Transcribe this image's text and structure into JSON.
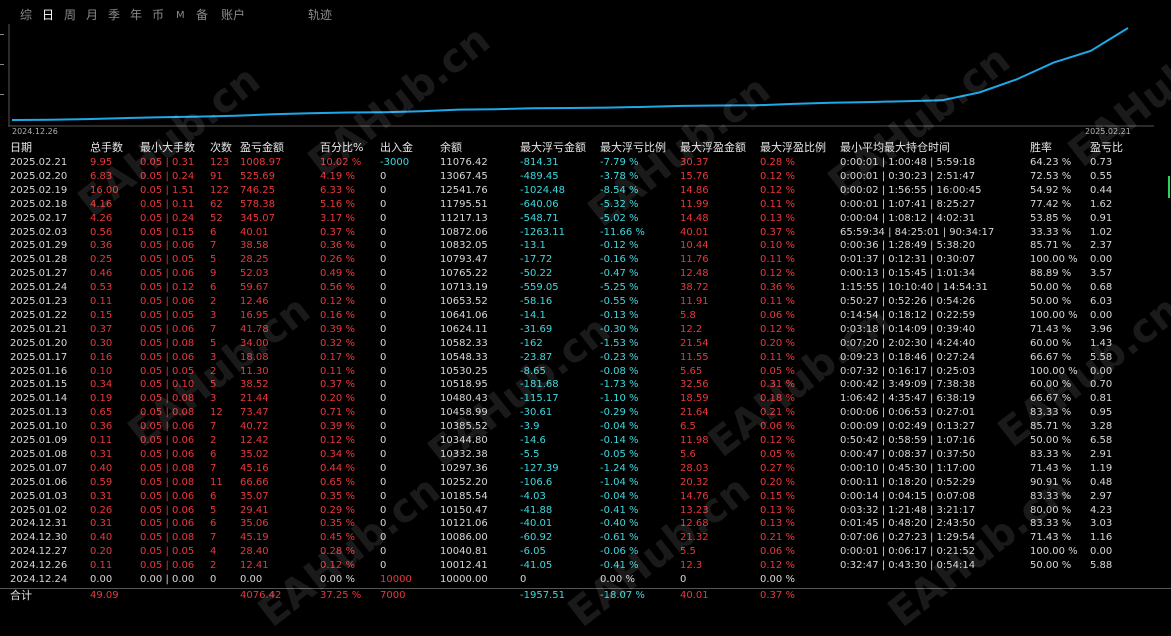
{
  "tabs": [
    {
      "label": "综",
      "active": false
    },
    {
      "label": "日",
      "active": true
    },
    {
      "label": "周",
      "active": false
    },
    {
      "label": "月",
      "active": false
    },
    {
      "label": "季",
      "active": false
    },
    {
      "label": "年",
      "active": false
    },
    {
      "label": "币",
      "active": false
    },
    {
      "label": "M",
      "active": false
    },
    {
      "label": "备",
      "active": false
    },
    {
      "label": "账户",
      "active": false
    },
    {
      "label": "轨迹",
      "active": false
    }
  ],
  "chart": {
    "start_date": "2024.12.26",
    "end_date": "2025.02.21",
    "line_color": "#1fa8e8"
  },
  "headers": [
    "日期",
    "总手数",
    "最小大手数",
    "次数",
    "盈亏金额",
    "百分比%",
    "出入金",
    "余额",
    "最大浮亏金额",
    "最大浮亏比例",
    "最大浮盈金额",
    "最大浮盈比例",
    "最小平均最大持仓时间",
    "胜率",
    "盈亏比"
  ],
  "rows": [
    [
      "2025.02.21",
      "9.95",
      "0.05 | 0.31",
      "123",
      "1008.97",
      "10.02 %",
      "-3000",
      "11076.42",
      "-814.31",
      "-7.79 %",
      "30.37",
      "0.28 %",
      "0:00:01 | 1:00:48 | 5:59:18",
      "64.23 %",
      "0.73"
    ],
    [
      "2025.02.20",
      "6.83",
      "0.05 | 0.24",
      "91",
      "525.69",
      "4.19 %",
      "0",
      "13067.45",
      "-489.45",
      "-3.78 %",
      "15.76",
      "0.12 %",
      "0:00:01 | 0:30:23 | 2:51:47",
      "72.53 %",
      "0.55"
    ],
    [
      "2025.02.19",
      "16.00",
      "0.05 | 1.51",
      "122",
      "746.25",
      "6.33 %",
      "0",
      "12541.76",
      "-1024.48",
      "-8.54 %",
      "14.86",
      "0.12 %",
      "0:00:02 | 1:56:55 | 16:00:45",
      "54.92 %",
      "0.44"
    ],
    [
      "2025.02.18",
      "4.16",
      "0.05 | 0.11",
      "62",
      "578.38",
      "5.16 %",
      "0",
      "11795.51",
      "-640.06",
      "-5.32 %",
      "11.99",
      "0.11 %",
      "0:00:01 | 1:07:41 | 8:25:27",
      "77.42 %",
      "1.62"
    ],
    [
      "2025.02.17",
      "4.26",
      "0.05 | 0.24",
      "52",
      "345.07",
      "3.17 %",
      "0",
      "11217.13",
      "-548.71",
      "-5.02 %",
      "14.48",
      "0.13 %",
      "0:00:04 | 1:08:12 | 4:02:31",
      "53.85 %",
      "0.91"
    ],
    [
      "2025.02.03",
      "0.56",
      "0.05 | 0.15",
      "6",
      "40.01",
      "0.37 %",
      "0",
      "10872.06",
      "-1263.11",
      "-11.66 %",
      "40.01",
      "0.37 %",
      "65:59:34 | 84:25:01 | 90:34:17",
      "33.33 %",
      "1.02"
    ],
    [
      "2025.01.29",
      "0.36",
      "0.05 | 0.06",
      "7",
      "38.58",
      "0.36 %",
      "0",
      "10832.05",
      "-13.1",
      "-0.12 %",
      "10.44",
      "0.10 %",
      "0:00:36 | 1:28:49 | 5:38:20",
      "85.71 %",
      "2.37"
    ],
    [
      "2025.01.28",
      "0.25",
      "0.05 | 0.05",
      "5",
      "28.25",
      "0.26 %",
      "0",
      "10793.47",
      "-17.72",
      "-0.16 %",
      "11.76",
      "0.11 %",
      "0:01:37 | 0:12:31 | 0:30:07",
      "100.00 %",
      "0.00"
    ],
    [
      "2025.01.27",
      "0.46",
      "0.05 | 0.06",
      "9",
      "52.03",
      "0.49 %",
      "0",
      "10765.22",
      "-50.22",
      "-0.47 %",
      "12.48",
      "0.12 %",
      "0:00:13 | 0:15:45 | 1:01:34",
      "88.89 %",
      "3.57"
    ],
    [
      "2025.01.24",
      "0.53",
      "0.05 | 0.12",
      "6",
      "59.67",
      "0.56 %",
      "0",
      "10713.19",
      "-559.05",
      "-5.25 %",
      "38.72",
      "0.36 %",
      "1:15:55 | 10:10:40 | 14:54:31",
      "50.00 %",
      "0.68"
    ],
    [
      "2025.01.23",
      "0.11",
      "0.05 | 0.06",
      "2",
      "12.46",
      "0.12 %",
      "0",
      "10653.52",
      "-58.16",
      "-0.55 %",
      "11.91",
      "0.11 %",
      "0:50:27 | 0:52:26 | 0:54:26",
      "50.00 %",
      "6.03"
    ],
    [
      "2025.01.22",
      "0.15",
      "0.05 | 0.05",
      "3",
      "16.95",
      "0.16 %",
      "0",
      "10641.06",
      "-14.1",
      "-0.13 %",
      "5.8",
      "0.06 %",
      "0:14:54 | 0:18:12 | 0:22:59",
      "100.00 %",
      "0.00"
    ],
    [
      "2025.01.21",
      "0.37",
      "0.05 | 0.06",
      "7",
      "41.78",
      "0.39 %",
      "0",
      "10624.11",
      "-31.69",
      "-0.30 %",
      "12.2",
      "0.12 %",
      "0:03:18 | 0:14:09 | 0:39:40",
      "71.43 %",
      "3.96"
    ],
    [
      "2025.01.20",
      "0.30",
      "0.05 | 0.08",
      "5",
      "34.00",
      "0.32 %",
      "0",
      "10582.33",
      "-162",
      "-1.53 %",
      "21.54",
      "0.20 %",
      "0:07:20 | 2:02:30 | 4:24:40",
      "60.00 %",
      "1.43"
    ],
    [
      "2025.01.17",
      "0.16",
      "0.05 | 0.06",
      "3",
      "18.08",
      "0.17 %",
      "0",
      "10548.33",
      "-23.87",
      "-0.23 %",
      "11.55",
      "0.11 %",
      "0:09:23 | 0:18:46 | 0:27:24",
      "66.67 %",
      "5.58"
    ],
    [
      "2025.01.16",
      "0.10",
      "0.05 | 0.05",
      "2",
      "11.30",
      "0.11 %",
      "0",
      "10530.25",
      "-8.65",
      "-0.08 %",
      "5.65",
      "0.05 %",
      "0:07:32 | 0:16:17 | 0:25:03",
      "100.00 %",
      "0.00"
    ],
    [
      "2025.01.15",
      "0.34",
      "0.05 | 0.10",
      "5",
      "38.52",
      "0.37 %",
      "0",
      "10518.95",
      "-181.68",
      "-1.73 %",
      "32.56",
      "0.31 %",
      "0:00:42 | 3:49:09 | 7:38:38",
      "60.00 %",
      "0.70"
    ],
    [
      "2025.01.14",
      "0.19",
      "0.05 | 0.08",
      "3",
      "21.44",
      "0.20 %",
      "0",
      "10480.43",
      "-115.17",
      "-1.10 %",
      "18.59",
      "0.18 %",
      "1:06:42 | 4:35:47 | 6:38:19",
      "66.67 %",
      "0.81"
    ],
    [
      "2025.01.13",
      "0.65",
      "0.05 | 0.08",
      "12",
      "73.47",
      "0.71 %",
      "0",
      "10458.99",
      "-30.61",
      "-0.29 %",
      "21.64",
      "0.21 %",
      "0:00:06 | 0:06:53 | 0:27:01",
      "83.33 %",
      "0.95"
    ],
    [
      "2025.01.10",
      "0.36",
      "0.05 | 0.06",
      "7",
      "40.72",
      "0.39 %",
      "0",
      "10385.52",
      "-3.9",
      "-0.04 %",
      "6.5",
      "0.06 %",
      "0:00:09 | 0:02:49 | 0:13:27",
      "85.71 %",
      "3.28"
    ],
    [
      "2025.01.09",
      "0.11",
      "0.05 | 0.06",
      "2",
      "12.42",
      "0.12 %",
      "0",
      "10344.80",
      "-14.6",
      "-0.14 %",
      "11.98",
      "0.12 %",
      "0:50:42 | 0:58:59 | 1:07:16",
      "50.00 %",
      "6.58"
    ],
    [
      "2025.01.08",
      "0.31",
      "0.05 | 0.06",
      "6",
      "35.02",
      "0.34 %",
      "0",
      "10332.38",
      "-5.5",
      "-0.05 %",
      "5.6",
      "0.05 %",
      "0:00:47 | 0:08:37 | 0:37:50",
      "83.33 %",
      "2.91"
    ],
    [
      "2025.01.07",
      "0.40",
      "0.05 | 0.08",
      "7",
      "45.16",
      "0.44 %",
      "0",
      "10297.36",
      "-127.39",
      "-1.24 %",
      "28.03",
      "0.27 %",
      "0:00:10 | 0:45:30 | 1:17:00",
      "71.43 %",
      "1.19"
    ],
    [
      "2025.01.06",
      "0.59",
      "0.05 | 0.08",
      "11",
      "66.66",
      "0.65 %",
      "0",
      "10252.20",
      "-106.6",
      "-1.04 %",
      "20.32",
      "0.20 %",
      "0:00:11 | 0:18:20 | 0:52:29",
      "90.91 %",
      "0.48"
    ],
    [
      "2025.01.03",
      "0.31",
      "0.05 | 0.06",
      "6",
      "35.07",
      "0.35 %",
      "0",
      "10185.54",
      "-4.03",
      "-0.04 %",
      "14.76",
      "0.15 %",
      "0:00:14 | 0:04:15 | 0:07:08",
      "83.33 %",
      "2.97"
    ],
    [
      "2025.01.02",
      "0.26",
      "0.05 | 0.06",
      "5",
      "29.41",
      "0.29 %",
      "0",
      "10150.47",
      "-41.88",
      "-0.41 %",
      "13.23",
      "0.13 %",
      "0:03:32 | 1:21:48 | 3:21:17",
      "80.00 %",
      "4.23"
    ],
    [
      "2024.12.31",
      "0.31",
      "0.05 | 0.06",
      "6",
      "35.06",
      "0.35 %",
      "0",
      "10121.06",
      "-40.01",
      "-0.40 %",
      "12.68",
      "0.13 %",
      "0:01:45 | 0:48:20 | 2:43:50",
      "83.33 %",
      "3.03"
    ],
    [
      "2024.12.30",
      "0.40",
      "0.05 | 0.08",
      "7",
      "45.19",
      "0.45 %",
      "0",
      "10086.00",
      "-60.92",
      "-0.61 %",
      "21.32",
      "0.21 %",
      "0:07:06 | 0:27:23 | 1:29:54",
      "71.43 %",
      "1.16"
    ],
    [
      "2024.12.27",
      "0.20",
      "0.05 | 0.05",
      "4",
      "28.40",
      "0.28 %",
      "0",
      "10040.81",
      "-6.05",
      "-0.06 %",
      "5.5",
      "0.06 %",
      "0:00:01 | 0:06:17 | 0:21:52",
      "100.00 %",
      "0.00"
    ],
    [
      "2024.12.26",
      "0.11",
      "0.05 | 0.06",
      "2",
      "12.41",
      "0.12 %",
      "0",
      "10012.41",
      "-41.05",
      "-0.41 %",
      "12.3",
      "0.12 %",
      "0:32:47 | 0:43:30 | 0:54:14",
      "50.00 %",
      "5.88"
    ],
    [
      "2024.12.24",
      "0.00",
      "0.00 | 0.00",
      "0",
      "0.00",
      "0.00 %",
      "10000",
      "10000.00",
      "0",
      "0.00 %",
      "0",
      "0.00 %",
      "",
      "",
      ""
    ]
  ],
  "totals": [
    "合计",
    "49.09",
    "",
    "",
    "4076.42",
    "37.25 %",
    "7000",
    "",
    "-1957.51",
    "-18.07 %",
    "40.01",
    "0.37 %",
    "",
    "",
    ""
  ],
  "watermark": "EAHub.cn",
  "colors": {
    "positive": "#e8383d",
    "negative": "#3fd8de",
    "neutral": "#d8d8d8"
  }
}
